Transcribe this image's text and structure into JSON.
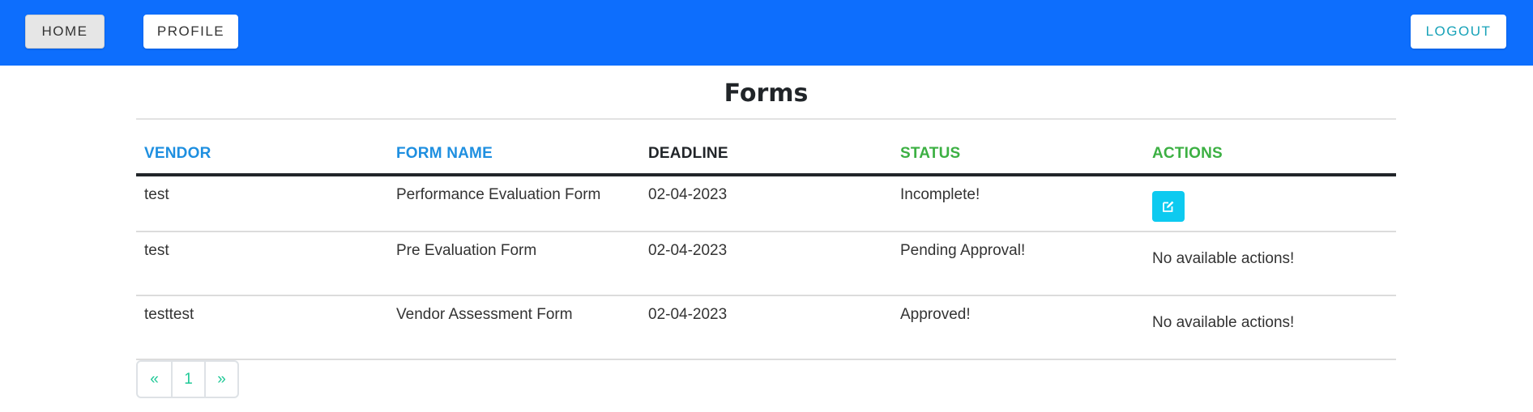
{
  "nav": {
    "home_label": "HOME",
    "profile_label": "PROFILE",
    "logout_label": "LOGOUT"
  },
  "page_title": "Forms",
  "table": {
    "headers": [
      "VENDOR",
      "FORM NAME",
      "DEADLINE",
      "STATUS",
      "ACTIONS"
    ],
    "rows": [
      {
        "vendor": "test",
        "form_name": "Performance Evaluation Form",
        "deadline": "02-04-2023",
        "status": "Incomplete!",
        "status_color": "#333333",
        "action": "edit",
        "action_icon": "edit-icon"
      },
      {
        "vendor": "test",
        "form_name": "Pre Evaluation Form",
        "deadline": "02-04-2023",
        "status": "Pending Approval!",
        "status_color": "#f0a500",
        "action_text": "No available actions!"
      },
      {
        "vendor": "testtest",
        "form_name": "Vendor Assessment Form",
        "deadline": "02-04-2023",
        "status": "Approved!",
        "status_color": "#1a8a1a",
        "action_text": "No available actions!"
      }
    ]
  },
  "pagination": {
    "prev": "«",
    "current": "1",
    "next": "»"
  },
  "colors": {
    "navbar": "#0d6efd",
    "header_blue": "#1e8fe0",
    "header_green": "#3cb043",
    "edit_button": "#0dcaf0",
    "pagination_text": "#20c997"
  }
}
